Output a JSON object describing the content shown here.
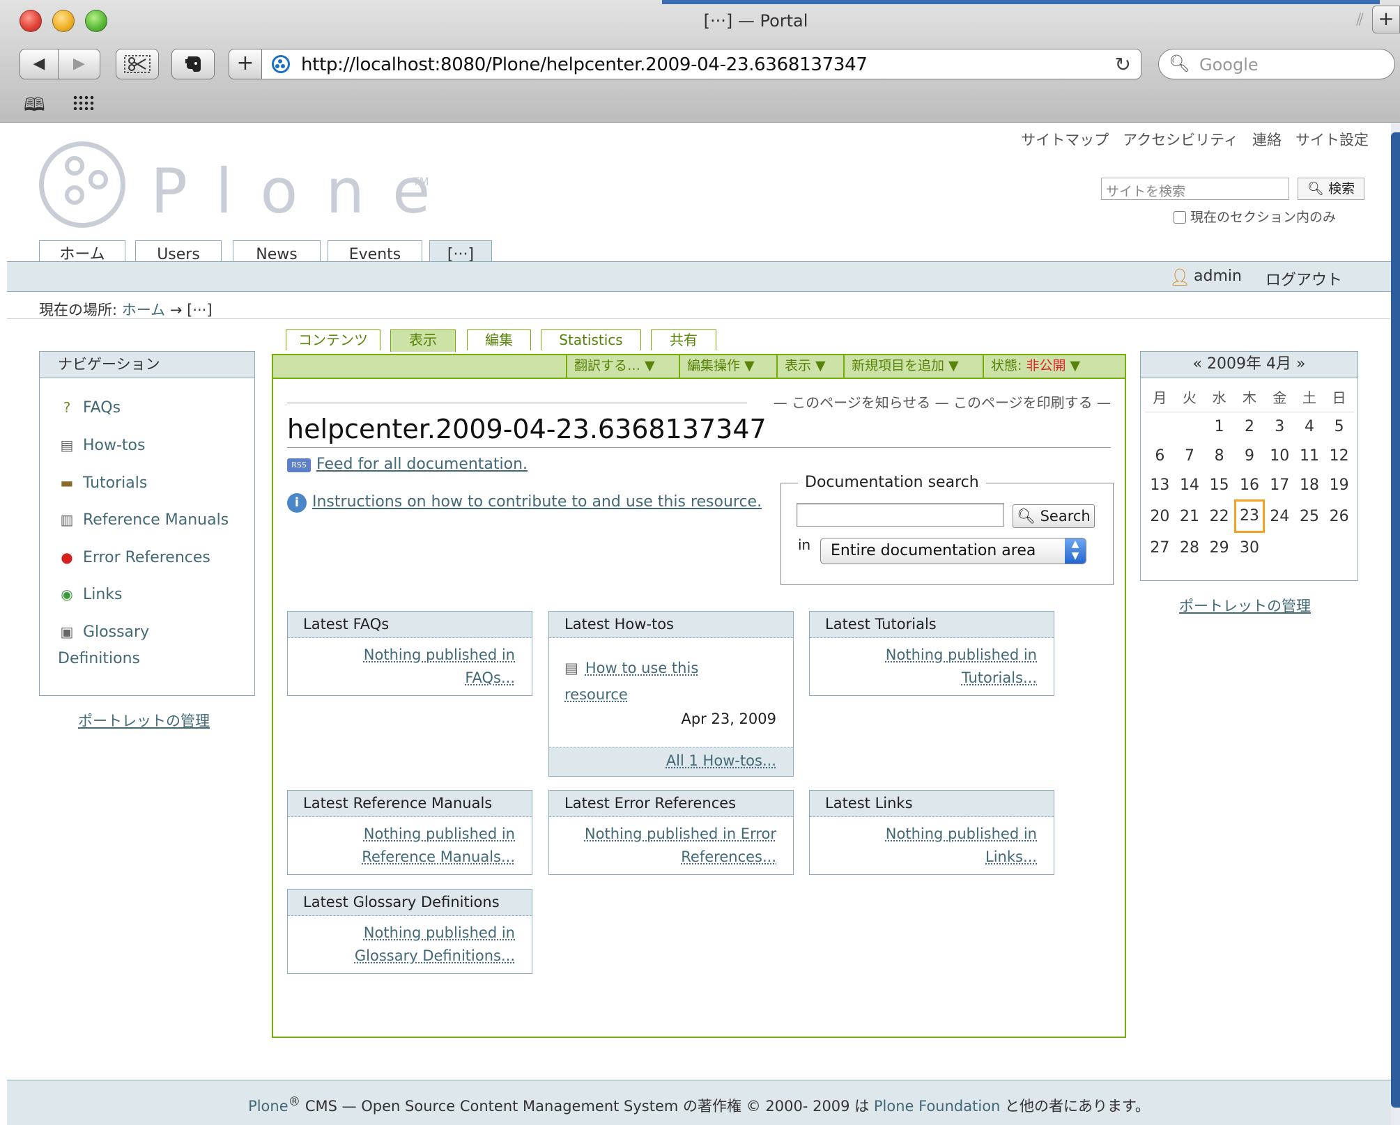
{
  "browser": {
    "window_title": "[···] — Portal",
    "url": "http://localhost:8080/Plone/helpcenter.2009-04-23.6368137347",
    "search_placeholder": "Google",
    "reload_glyph": "↻",
    "back_glyph": "◀",
    "forward_glyph": "▶",
    "add_glyph": "+",
    "newtab_glyph": "+"
  },
  "site": {
    "actions": [
      "サイトマップ",
      "アクセシビリティ",
      "連絡",
      "サイト設定"
    ],
    "logo_text": "Plone",
    "logo_tm": "TM",
    "search_placeholder": "サイトを検索",
    "search_button": "検索",
    "section_only_label": "現在のセクション内のみ",
    "global_tabs": [
      "ホーム",
      "Users",
      "News",
      "Events",
      "[···]"
    ],
    "selected_tab_index": 4,
    "user_name": "admin",
    "logout_label": "ログアウト",
    "breadcrumb_prefix": "現在の場所:",
    "breadcrumb_home": "ホーム",
    "breadcrumb_arrow": "→",
    "breadcrumb_current": "[···]"
  },
  "nav_portlet": {
    "title": "ナビゲーション",
    "items": [
      {
        "label": "FAQs",
        "icon": "faq-icon"
      },
      {
        "label": "How-tos",
        "icon": "howto-icon"
      },
      {
        "label": "Tutorials",
        "icon": "tutorial-icon"
      },
      {
        "label": "Reference Manuals",
        "icon": "reference-manual-icon"
      },
      {
        "label": "Error References",
        "icon": "error-reference-icon"
      },
      {
        "label": "Links",
        "icon": "link-icon"
      },
      {
        "label": "Glossary",
        "label2": "Definitions",
        "icon": "glossary-icon"
      }
    ],
    "manage_label": "ポートレットの管理"
  },
  "calendar": {
    "title": "« 2009年 4月 »",
    "weekdays": [
      "月",
      "火",
      "水",
      "木",
      "金",
      "土",
      "日"
    ],
    "weeks": [
      [
        "",
        "",
        "1",
        "2",
        "3",
        "4",
        "5"
      ],
      [
        "6",
        "7",
        "8",
        "9",
        "10",
        "11",
        "12"
      ],
      [
        "13",
        "14",
        "15",
        "16",
        "17",
        "18",
        "19"
      ],
      [
        "20",
        "21",
        "22",
        "23",
        "24",
        "25",
        "26"
      ],
      [
        "27",
        "28",
        "29",
        "30",
        "",
        "",
        ""
      ]
    ],
    "today": "23",
    "manage_label": "ポートレットの管理"
  },
  "content": {
    "tabs": [
      "コンテンツ",
      "表示",
      "編集",
      "Statistics",
      "共有"
    ],
    "selected_tab_index": 1,
    "actions": [
      "翻訳する… ▼",
      "編集操作 ▼",
      "表示 ▼",
      "新規項目を追加 ▼"
    ],
    "state_label": "状態:",
    "state_value": "非公開",
    "state_arrow": "▼",
    "doc_actions": "— このページを知らせる — このページを印刷する —",
    "title": "helpcenter.2009-04-23.6368137347",
    "rss_badge": "RSS",
    "feed_link": "Feed for all documentation.",
    "instructions_link": "Instructions on how to contribute to and use this resource.",
    "doc_search": {
      "legend": "Documentation search",
      "button": "Search",
      "in_label": "in",
      "select_value": "Entire documentation area"
    },
    "boxes": [
      {
        "title": "Latest FAQs",
        "empty": "Nothing published in FAQs..."
      },
      {
        "title": "Latest How-tos",
        "item": "How to use this resource",
        "date": "Apr 23, 2009",
        "footer": "All 1 How-tos..."
      },
      {
        "title": "Latest Tutorials",
        "empty": "Nothing published in Tutorials..."
      },
      {
        "title": "Latest Reference Manuals",
        "empty": "Nothing published in Reference Manuals..."
      },
      {
        "title": "Latest Error References",
        "empty": "Nothing published in Error References..."
      },
      {
        "title": "Latest Links",
        "empty": "Nothing published in Links..."
      },
      {
        "title": "Latest Glossary Definitions",
        "empty": "Nothing published in Glossary Definitions..."
      }
    ]
  },
  "footer": {
    "plone": "Plone",
    "reg": "®",
    "text1": " CMS — Open Source Content Management System の著作権 © 2000- 2009 は ",
    "foundation": "Plone Foundation",
    "text2": " と他の者にあります。"
  },
  "colors": {
    "chrome_accent": "#3b6db3",
    "plone_blue_border": "#8cacbb",
    "plone_blue_bg": "#dee7ec",
    "content_green": "#74ae0b",
    "content_green_bg": "#cde2a7",
    "link": "#436976",
    "state_private": "#e0212c",
    "today_highlight": "#f4a020"
  }
}
